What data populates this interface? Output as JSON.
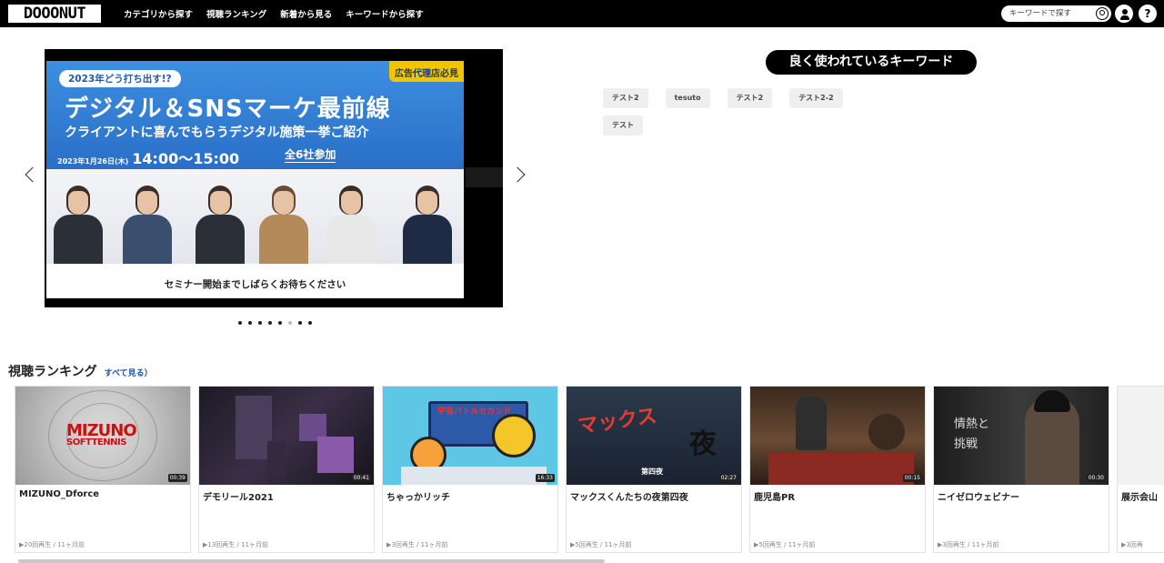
{
  "header": {
    "logo": "DOOONUT",
    "nav": [
      "カテゴリから探す",
      "視聴ランキング",
      "新着から見る",
      "キーワードから探す"
    ],
    "search_placeholder": "キーワードで探す",
    "help": "?"
  },
  "carousel": {
    "banner_tag": "広告代理店必見",
    "banner_pill": "2023年どう打ち出す!?",
    "banner_title": "デジタル＆SNSマーケ最前線",
    "banner_sub": "クライアントに喜んでもらうデジタル施策一挙ご紹介",
    "banner_date": "2023年1月26日(木)",
    "banner_time": "14:00～15:00",
    "banner_count": "全6社参加",
    "banner_footer": "セミナー開始までしばらくお待ちください",
    "dots_count": 8,
    "active_dot": 5
  },
  "keywords": {
    "title": "良く使われているキーワード",
    "items": [
      "テスト2",
      "tesuto",
      "テスト2",
      "テスト2-2",
      "テスト"
    ]
  },
  "ranking": {
    "title": "視聴ランキング",
    "more": "すべて見る）",
    "videos": [
      {
        "title": "MIZUNO_Dforce",
        "duration": "00:39",
        "meta": "▶20回再生 / 11ヶ月前",
        "thumb_text": "MIZUNO",
        "thumb_text2": "SOFTTENNIS"
      },
      {
        "title": "デモリール2021",
        "duration": "00:41",
        "meta": "▶13回再生 / 11ヶ月前"
      },
      {
        "title": "ちゃっかリッチ",
        "duration": "16:33",
        "meta": "▶3回再生 / 11ヶ月前",
        "thumb_text": "宇宙バトルセカンド"
      },
      {
        "title": "マックスくんたちの夜第四夜",
        "duration": "02:27",
        "meta": "▶5回再生 / 11ヶ月前",
        "thumb_text": "マックス",
        "thumb_text2": "夜",
        "thumb_text3": "第四夜"
      },
      {
        "title": "鹿児島PR",
        "duration": "00:15",
        "meta": "▶5回再生 / 11ヶ月前"
      },
      {
        "title": "ニイゼロウェビナー",
        "duration": "00:30",
        "meta": "▶3回再生 / 11ヶ月前",
        "thumb_text": "情熱と",
        "thumb_text2": "挑戦"
      },
      {
        "title": "展示会山",
        "meta": "▶3回再"
      }
    ]
  }
}
